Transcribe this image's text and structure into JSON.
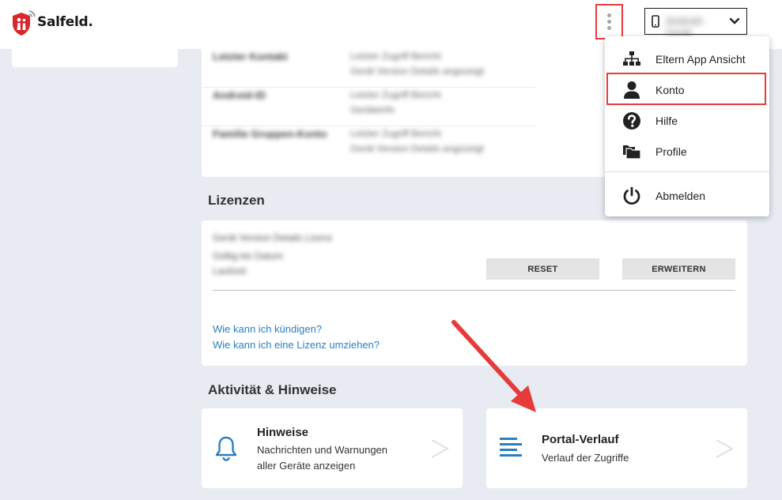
{
  "brand": {
    "name": "Salfeld."
  },
  "header": {
    "device_name": "Android-Gerät"
  },
  "info_rows": [
    {
      "key": "Letzter Kontakt",
      "value1": "Letzter Zugriff Bericht",
      "value2": "Gerät Version Details angezeigt"
    },
    {
      "key": "Android-ID",
      "value1": "Letzter Zugriff Bericht",
      "value2": "Geräteinfo"
    },
    {
      "key": "Familie Gruppen-Konto",
      "value1": "Letzter Zugriff Bericht",
      "value2": "Gerät Version Details angezeigt"
    }
  ],
  "licenses": {
    "title": "Lizenzen",
    "lines": [
      "Gerät Version Details Lizenz",
      "Gültig bis Datum",
      "Laufzeit"
    ],
    "reset_label": "RESET",
    "extend_label": "ERWEITERN",
    "link_cancel": "Wie kann ich kündigen?",
    "link_move": "Wie kann ich eine Lizenz umziehen?"
  },
  "activity": {
    "title": "Aktivität & Hinweise",
    "notices": {
      "title": "Hinweise",
      "desc1": "Nachrichten und Warnungen",
      "desc2": "aller Geräte anzeigen"
    },
    "portal": {
      "title": "Portal-Verlauf",
      "desc": "Verlauf der Zugriffe"
    }
  },
  "menu": {
    "items": [
      {
        "label": "Eltern App Ansicht",
        "icon": "sitemap-icon"
      },
      {
        "label": "Konto",
        "icon": "user-icon"
      },
      {
        "label": "Hilfe",
        "icon": "question-icon"
      },
      {
        "label": "Profile",
        "icon": "folders-icon"
      },
      {
        "label": "Abmelden",
        "icon": "power-icon"
      }
    ]
  },
  "colors": {
    "accent_link": "#2b7fc1",
    "highlight_border": "#e63b3b",
    "brand_red": "#d9262b",
    "page_background": "#e8ebf2"
  }
}
